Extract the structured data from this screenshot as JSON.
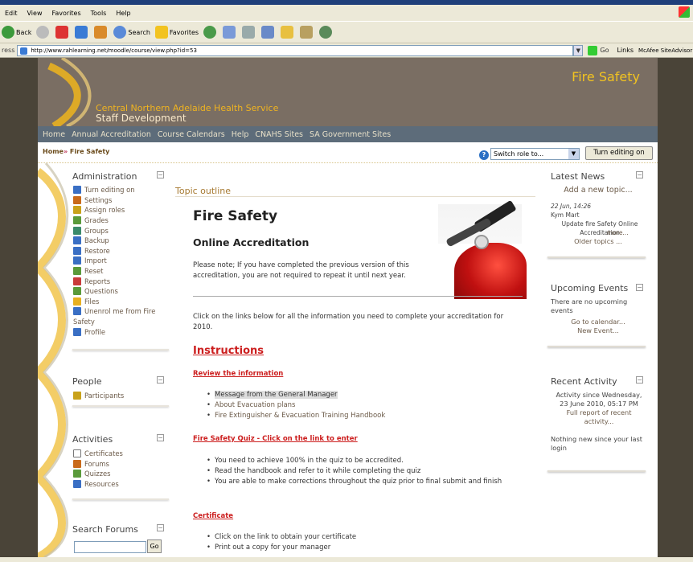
{
  "browser": {
    "menu": [
      "Edit",
      "View",
      "Favorites",
      "Tools",
      "Help"
    ],
    "toolbar": {
      "back": "Back",
      "search": "Search",
      "favorites": "Favorites"
    },
    "address_label": "ress",
    "url": "http://www.rahlearning.net/moodle/course/view.php?id=53",
    "go": "Go",
    "links": "Links",
    "addon": "McAfee SiteAdvisor"
  },
  "header": {
    "site_title": "Fire Safety",
    "org_line1": "Central Northern Adelaide Health Service",
    "org_line2": "Staff Development"
  },
  "nav": [
    "Home",
    "Annual Accreditation",
    "Course Calendars",
    "Help",
    "CNAHS Sites",
    "SA Government Sites"
  ],
  "breadcrumb": {
    "home": "Home",
    "sep": "»",
    "current": "Fire Safety"
  },
  "role_select": {
    "value": "Switch role to..."
  },
  "turn_editing_button": "Turn editing on",
  "admin": {
    "title": "Administration",
    "items": [
      "Turn editing on",
      "Settings",
      "Assign roles",
      "Grades",
      "Groups",
      "Backup",
      "Restore",
      "Import",
      "Reset",
      "Reports",
      "Questions",
      "Files",
      "Unenrol me from Fire",
      "Safety",
      "Profile"
    ],
    "icon_colors": [
      "#3a6fc4",
      "#c96a1a",
      "#c9a21a",
      "#5a9a3a",
      "#3a8a6a",
      "#3a6fc4",
      "#3a6fc4",
      "#3a6fc4",
      "#5a9a3a",
      "#c93a3a",
      "#5a9a3a",
      "#e8b020",
      "#3a6fc4",
      "",
      "#3a6fc4"
    ]
  },
  "people": {
    "title": "People",
    "items": [
      "Participants"
    ]
  },
  "activities": {
    "title": "Activities",
    "items": [
      "Certificates",
      "Forums",
      "Quizzes",
      "Resources"
    ]
  },
  "search_forums": {
    "title": "Search Forums",
    "go": "Go"
  },
  "main": {
    "topic_outline": "Topic outline",
    "heading": "Fire Safety",
    "subheading": "Online Accreditation",
    "note": "Please note; If you have completed the previous version of this accreditation, you are not required to repeat it until next year.",
    "click_text": "Click on the links below for all the information you need to complete your accreditation for 2010.",
    "instructions": "Instructions",
    "review_link": "Review the information",
    "review_items": [
      "Message from the General Manager",
      "About Evacuation plans",
      "Fire Extinguisher & Evacuation Training Handbook"
    ],
    "quiz_link": "Fire Safety Quiz - Click on the link to enter",
    "quiz_items": [
      "You need to achieve 100% in the quiz to be accredited.",
      "Read the handbook and refer to it while completing the quiz",
      "You are able to make corrections throughout the quiz prior to final submit and finish"
    ],
    "cert_link": "Certificate",
    "cert_items": [
      "Click on the link to obtain your certificate",
      "Print out a copy for your manager"
    ]
  },
  "latest_news": {
    "title": "Latest News",
    "add": "Add a new topic...",
    "date": "22 Jun, 14:26",
    "author": "Kym Mart",
    "post": "Update fire Safety Online Accreditation",
    "more": "more...",
    "older": "Older topics ..."
  },
  "upcoming": {
    "title": "Upcoming Events",
    "text": "There are no upcoming events",
    "calendar": "Go to calendar...",
    "new_event": "New Event..."
  },
  "recent": {
    "title": "Recent Activity",
    "since": "Activity since Wednesday, 23 June 2010, 05:17 PM",
    "full_report": "Full report of recent activity...",
    "nothing": "Nothing new since your last login"
  }
}
